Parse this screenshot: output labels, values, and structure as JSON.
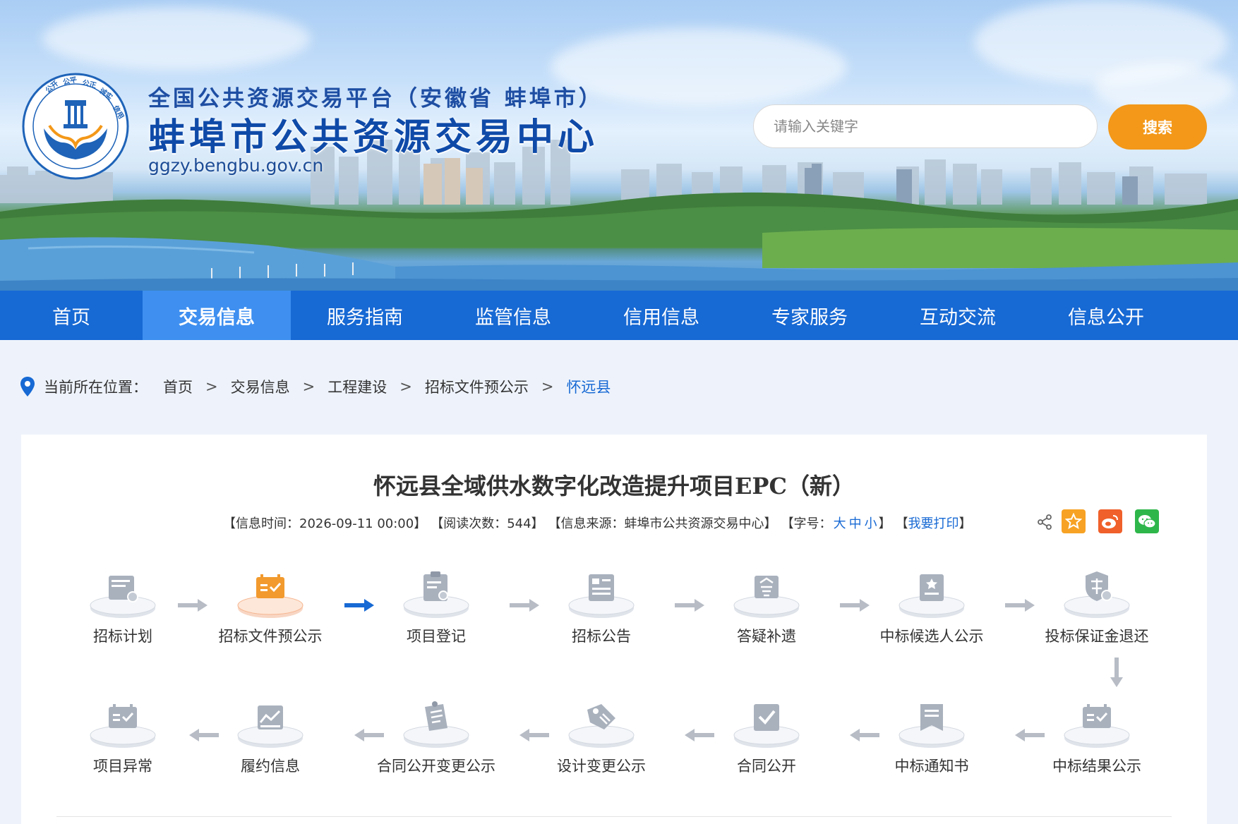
{
  "header": {
    "subtitle": "全国公共资源交易平台（安徽省 蚌埠市）",
    "title": "蚌埠市公共资源交易中心",
    "url": "ggzy.bengbu.gov.cn",
    "logo_text": "公开 公平 公正 诚实 信用",
    "search": {
      "placeholder": "请输入关键字",
      "button_label": "搜索"
    }
  },
  "nav": {
    "items": [
      {
        "label": "首页"
      },
      {
        "label": "交易信息",
        "active": true
      },
      {
        "label": "服务指南"
      },
      {
        "label": "监管信息"
      },
      {
        "label": "信用信息"
      },
      {
        "label": "专家服务"
      },
      {
        "label": "互动交流"
      },
      {
        "label": "信息公开"
      }
    ]
  },
  "breadcrumb": {
    "label": "当前所在位置：",
    "separator": ">",
    "items": [
      "首页",
      "交易信息",
      "工程建设",
      "招标文件预公示",
      "怀远县"
    ]
  },
  "article": {
    "title": "怀远县全域供水数字化改造提升项目EPC（新）",
    "meta": {
      "time": "【信息时间：2026-09-11 00:00】",
      "views": "【阅读次数：544】",
      "source": "【信息来源：蚌埠市公共资源交易中心】",
      "font_prefix": "【字号：",
      "font_large": "大",
      "font_medium": "中",
      "font_small": "小",
      "font_suffix": "】",
      "print_open": "【",
      "print": "我要打印",
      "print_close": "】"
    }
  },
  "process": {
    "row1": [
      {
        "label": "招标计划"
      },
      {
        "label": "招标文件预公示",
        "active": true
      },
      {
        "label": "项目登记"
      },
      {
        "label": "招标公告"
      },
      {
        "label": "答疑补遗"
      },
      {
        "label": "中标候选人公示"
      },
      {
        "label": "投标保证金退还"
      }
    ],
    "row2": [
      {
        "label": "项目异常"
      },
      {
        "label": "履约信息"
      },
      {
        "label": "合同公开变更公示"
      },
      {
        "label": "设计变更公示"
      },
      {
        "label": "合同公开"
      },
      {
        "label": "中标通知书"
      },
      {
        "label": "中标结果公示"
      }
    ]
  },
  "colors": {
    "nav_bg": "#1769d4",
    "nav_active": "#3e8ff0",
    "search_button": "#f39819",
    "accent_blue": "#1769d4",
    "active_step": "#f29a2e"
  }
}
